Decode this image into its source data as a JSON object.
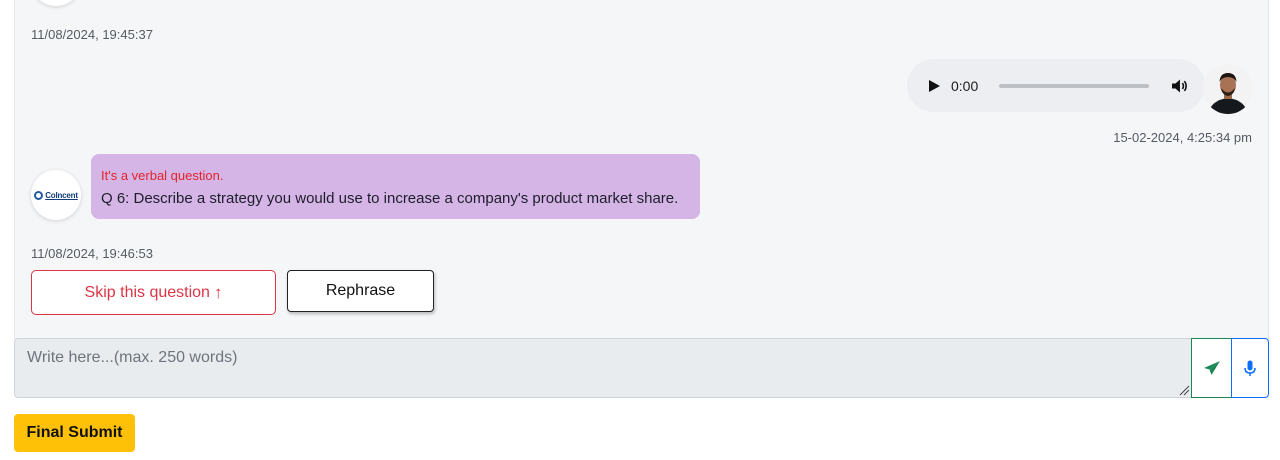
{
  "chat": {
    "timestamp_1": "11/08/2024, 19:45:37",
    "audio": {
      "time": "0:00",
      "progress": 0
    },
    "timestamp_2": "15-02-2024, 4:25:34 pm",
    "bot_logo_text": "CoIncent",
    "question": {
      "note": "It's a verbal question.",
      "text": "Q 6: Describe a strategy you would use to increase a company's product market share."
    },
    "timestamp_3": "11/08/2024, 19:46:53"
  },
  "actions": {
    "skip_label": "Skip this question",
    "skip_arrow": "↑",
    "rephrase_label": "Rephrase"
  },
  "composer": {
    "placeholder": "Write here...(max. 250 words)",
    "value": ""
  },
  "footer": {
    "final_submit_label": "Final Submit"
  },
  "icons": {
    "play": "play-icon",
    "volume": "volume-icon",
    "send": "send-icon",
    "mic": "microphone-icon"
  },
  "colors": {
    "bubble": "#d4b5e6",
    "danger": "#dc3545",
    "success": "#198754",
    "primary": "#0d6efd",
    "warning": "#ffc107"
  }
}
